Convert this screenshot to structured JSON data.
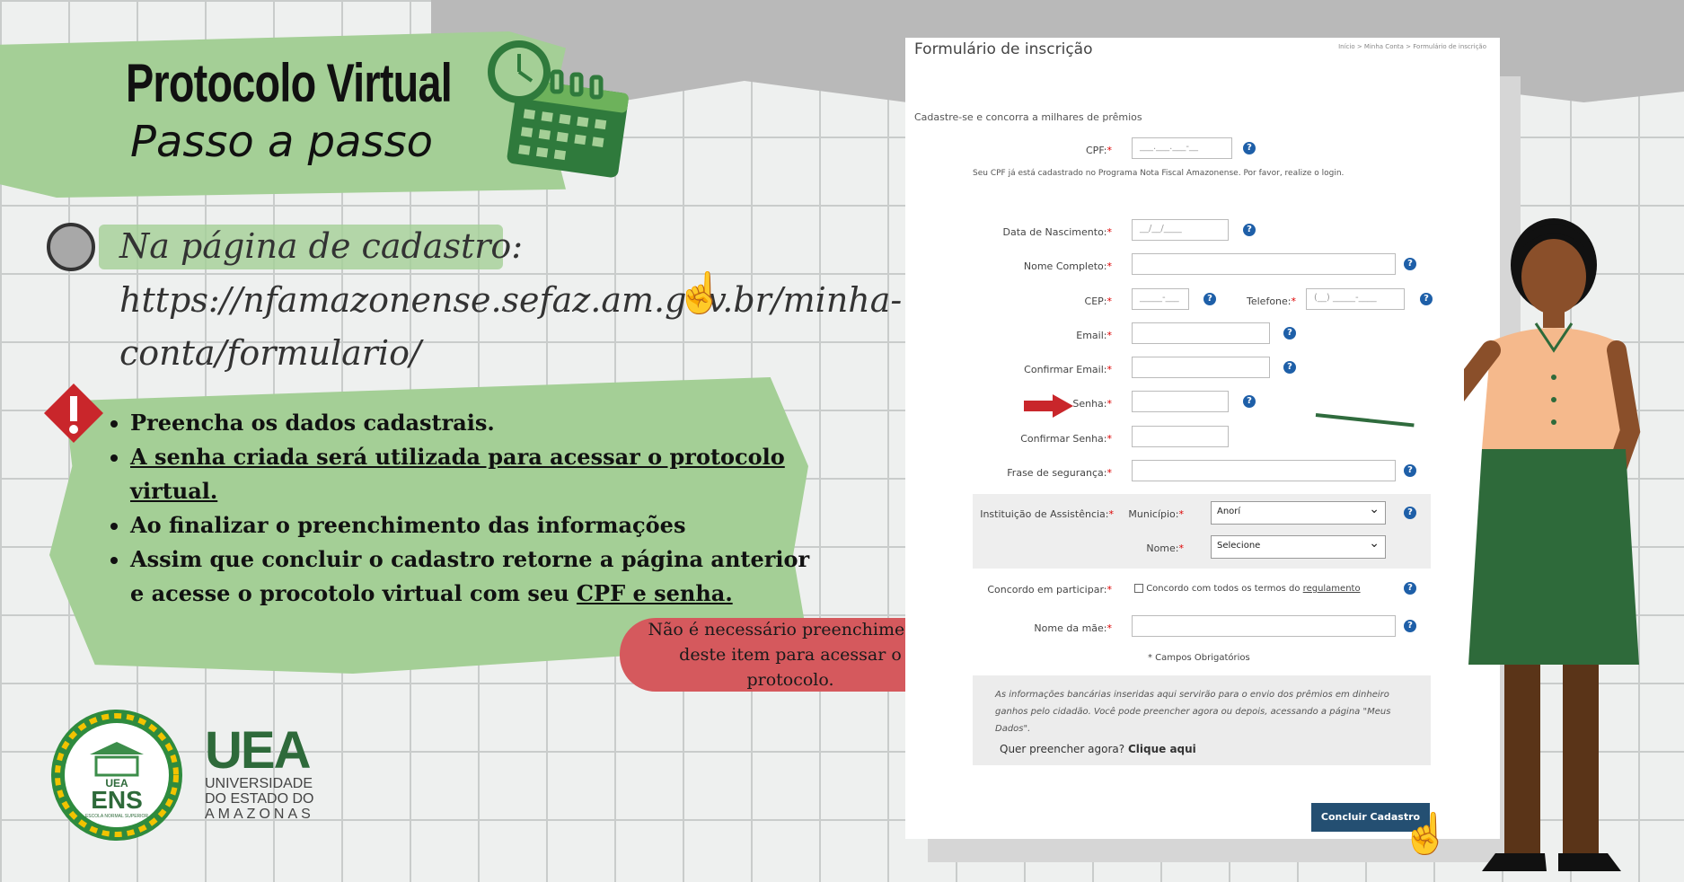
{
  "header": {
    "title": "Protocolo Virtual",
    "subtitle": "Passo a passo"
  },
  "cadastro": {
    "line1": "Na página de cadastro:",
    "line2": "https://nfamazonense.sefaz.am.gov.br/minha-",
    "line3": "conta/formulario/"
  },
  "instructions": {
    "item1": "Preencha os dados cadastrais.",
    "item2": "A senha criada será utilizada para acessar o protocolo virtual. ",
    "item3": "Ao finalizar o preenchimento das informações",
    "item4_a": "Assim que concluir o cadastro retorne a página anterior e acesse o procotolo virtual com seu ",
    "item4_b": "CPF e senha."
  },
  "bubble": "Não é necessário preenchimento deste item para acessar o protocolo.",
  "logos": {
    "ens_top": "UEA",
    "ens_main": "ENS",
    "ens_sub": "ESCOLA NORMAL SUPERIOR",
    "uea_big": "UEA",
    "uea_line1": "UNIVERSIDADE",
    "uea_line2": "DO ESTADO DO",
    "uea_line3": "AMAZONAS"
  },
  "form": {
    "title": "Formulário de inscrição",
    "breadcrumb": "Início  >  Minha Conta  >  Formulário de inscrição",
    "subtitle": "Cadastre-se e concorra a milhares de prêmios",
    "cpf_label": "CPF:",
    "cpf_placeholder": "___.___.___-__",
    "cpf_note": "Seu CPF já está cadastrado no Programa Nota Fiscal Amazonense. Por favor, realize o login.",
    "nascimento_label": "Data de Nascimento:",
    "nascimento_placeholder": "__/__/____",
    "nome_label": "Nome Completo:",
    "cep_label": "CEP:",
    "cep_placeholder": "_____-___",
    "telefone_label": "Telefone:",
    "telefone_placeholder": "(__) _____-____",
    "email_label": "Email:",
    "confirmar_email_label": "Confirmar Email:",
    "senha_label": "Senha:",
    "confirmar_senha_label": "Confirmar Senha:",
    "frase_label": "Frase de segurança:",
    "instituicao_label": "Instituição de Assistência:",
    "municipio_label": "Município:",
    "municipio_value": "Anorí",
    "nome_inst_label": "Nome:",
    "nome_inst_value": "Selecione",
    "concordo_label": "Concordo em participar:",
    "concordo_text": "Concordo com todos os termos do ",
    "regulamento": "regulamento",
    "mae_label": "Nome da mãe:",
    "campos_obrigatorios": "* Campos Obrigatórios",
    "info_text": "As informações bancárias inseridas aqui servirão para o envio dos prêmios em dinheiro ganhos pelo cidadão. Você pode preencher agora ou depois, acessando a página \"Meus Dados\".",
    "info_question": "Quer preencher agora? ",
    "info_link": "Clique aqui",
    "submit": "Concluir Cadastro",
    "required_mark": "*",
    "help": "?"
  },
  "colors": {
    "green_banner": "#a4cf96",
    "bubble_red": "#d5595d",
    "button_blue": "#244f72",
    "help_blue": "#1e5fa8",
    "uea_green": "#2e6a3a"
  }
}
